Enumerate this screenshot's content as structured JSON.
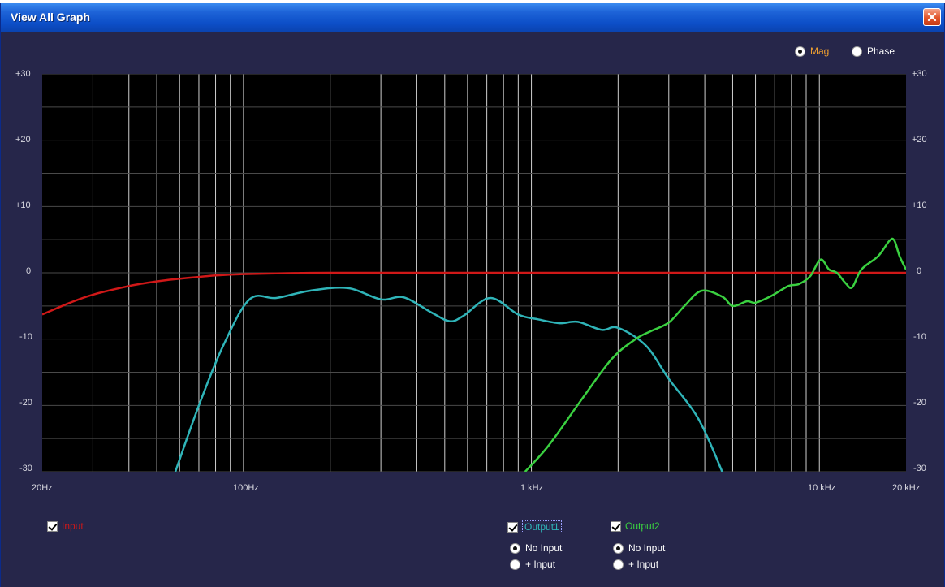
{
  "window": {
    "title": "View All Graph"
  },
  "mode": {
    "selected": "Mag",
    "mag_label": "Mag",
    "phase_label": "Phase",
    "mag_color": "#f0a030"
  },
  "chart_data": {
    "type": "line",
    "x_scale": "log",
    "xlim": [
      20,
      20000
    ],
    "ylim": [
      -30,
      30
    ],
    "y_ticks": [
      "+30",
      "+20",
      "+10",
      "0",
      "-10",
      "-20",
      "-30"
    ],
    "x_tick_labels": [
      {
        "value": 20,
        "label": "20Hz"
      },
      {
        "value": 100,
        "label": "100Hz"
      },
      {
        "value": 1000,
        "label": "1 kHz"
      },
      {
        "value": 10000,
        "label": "10 kHz"
      },
      {
        "value": 20000,
        "label": "20 kHz"
      }
    ],
    "grid": true,
    "series": [
      {
        "name": "Input",
        "color": "#d01818",
        "points": [
          [
            20,
            -6.3
          ],
          [
            25,
            -4.5
          ],
          [
            30,
            -3.3
          ],
          [
            40,
            -2.0
          ],
          [
            50,
            -1.3
          ],
          [
            60,
            -0.9
          ],
          [
            80,
            -0.4
          ],
          [
            100,
            -0.2
          ],
          [
            150,
            -0.05
          ],
          [
            200,
            0
          ],
          [
            1000,
            0
          ],
          [
            10000,
            0
          ],
          [
            20000,
            0
          ]
        ]
      },
      {
        "name": "Output1",
        "color": "#2fb4b8",
        "points": [
          [
            58,
            -30
          ],
          [
            70,
            -20
          ],
          [
            85,
            -11
          ],
          [
            105,
            -4
          ],
          [
            130,
            -3.8
          ],
          [
            170,
            -2.7
          ],
          [
            230,
            -2.3
          ],
          [
            300,
            -4
          ],
          [
            360,
            -3.7
          ],
          [
            450,
            -6
          ],
          [
            520,
            -7.3
          ],
          [
            580,
            -6.5
          ],
          [
            720,
            -3.8
          ],
          [
            900,
            -6.3
          ],
          [
            1050,
            -7
          ],
          [
            1250,
            -7.6
          ],
          [
            1450,
            -7.4
          ],
          [
            1750,
            -8.6
          ],
          [
            2000,
            -8.3
          ],
          [
            2500,
            -11
          ],
          [
            3000,
            -16
          ],
          [
            3800,
            -22
          ],
          [
            4600,
            -30
          ]
        ]
      },
      {
        "name": "Output2",
        "color": "#3ad040",
        "points": [
          [
            950,
            -30
          ],
          [
            1150,
            -26
          ],
          [
            1500,
            -19
          ],
          [
            1900,
            -13
          ],
          [
            2300,
            -10
          ],
          [
            2600,
            -8.8
          ],
          [
            3000,
            -7.5
          ],
          [
            3400,
            -5
          ],
          [
            3900,
            -2.7
          ],
          [
            4600,
            -3.6
          ],
          [
            5000,
            -5
          ],
          [
            5600,
            -4.3
          ],
          [
            6000,
            -4.5
          ],
          [
            6800,
            -3.5
          ],
          [
            7800,
            -2
          ],
          [
            8500,
            -1.7
          ],
          [
            9300,
            -0.5
          ],
          [
            10100,
            2
          ],
          [
            10800,
            0.5
          ],
          [
            11500,
            0
          ],
          [
            12300,
            -1.5
          ],
          [
            13000,
            -2.2
          ],
          [
            14000,
            0.5
          ],
          [
            16000,
            2.5
          ],
          [
            17500,
            4.8
          ],
          [
            18200,
            4.9
          ],
          [
            19000,
            2.5
          ],
          [
            20000,
            0.5
          ]
        ]
      }
    ]
  },
  "legend": {
    "input": {
      "label": "Input",
      "checked": true,
      "color": "#d01818"
    },
    "output1": {
      "label": "Output1",
      "checked": true,
      "color": "#2fb4b8",
      "no_input_label": "No Input",
      "plus_input_label": "+ Input"
    },
    "output2": {
      "label": "Output2",
      "checked": true,
      "color": "#3ad040",
      "no_input_label": "No Input",
      "plus_input_label": "+ Input"
    }
  }
}
